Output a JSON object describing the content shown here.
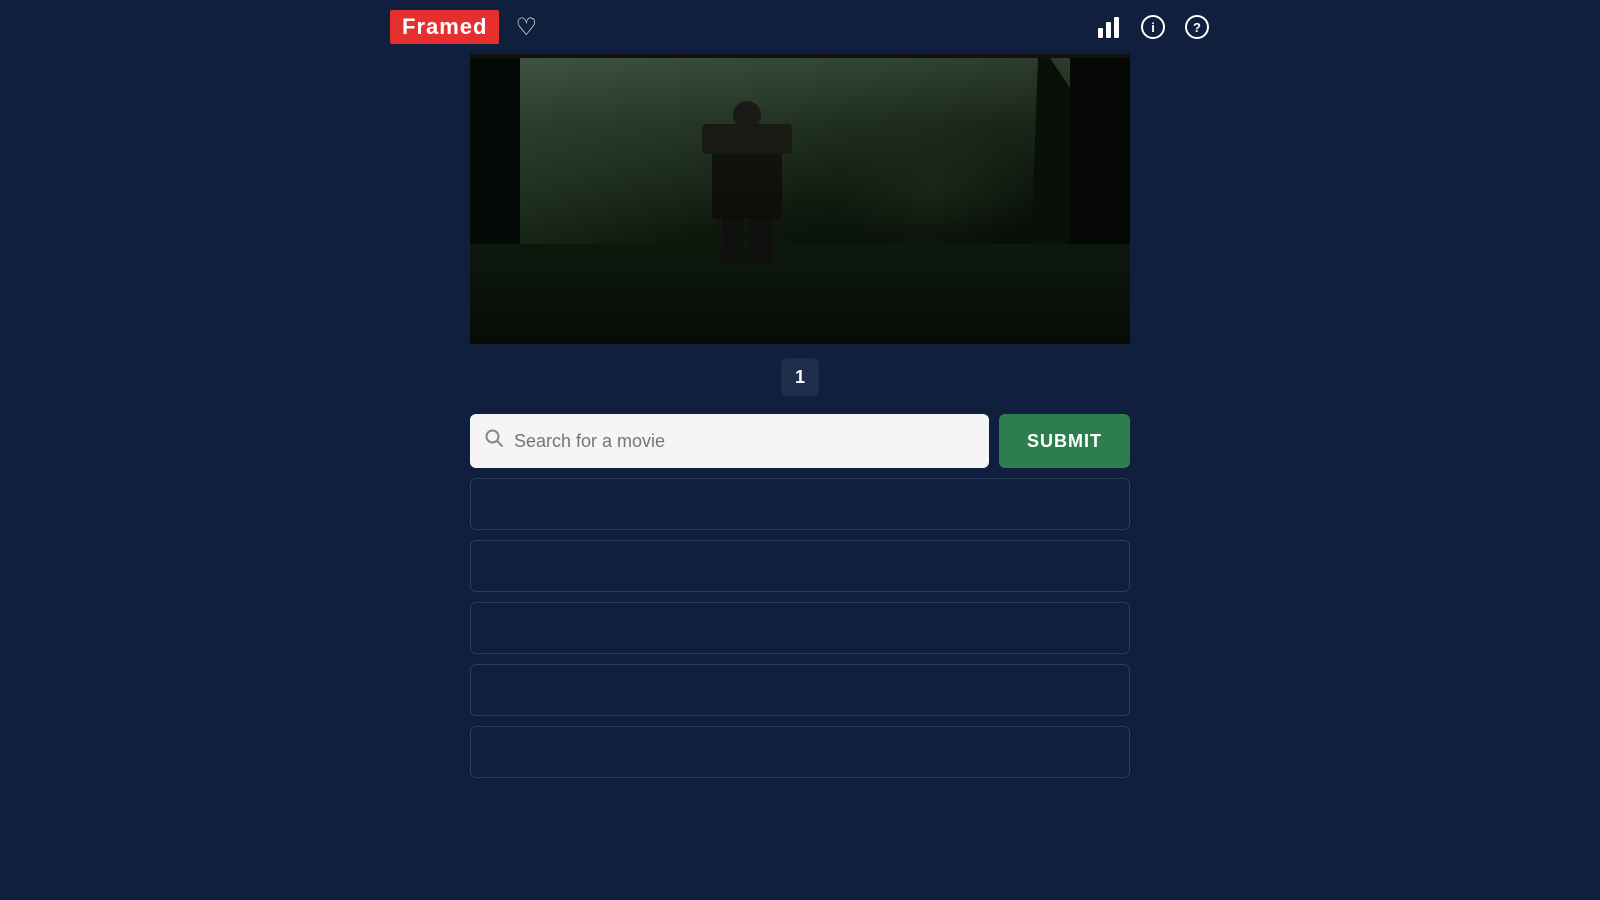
{
  "header": {
    "logo_text": "Framed",
    "logo_bg": "#e63030"
  },
  "icons": {
    "heart": "♡",
    "stats": "📊",
    "info": "ⓘ",
    "help": "?"
  },
  "frame_number": "1",
  "search": {
    "placeholder": "Search for a movie",
    "submit_label": "SUBMIT"
  },
  "guess_slots": [
    {
      "id": 1,
      "value": ""
    },
    {
      "id": 2,
      "value": ""
    },
    {
      "id": 3,
      "value": ""
    },
    {
      "id": 4,
      "value": ""
    },
    {
      "id": 5,
      "value": ""
    }
  ]
}
